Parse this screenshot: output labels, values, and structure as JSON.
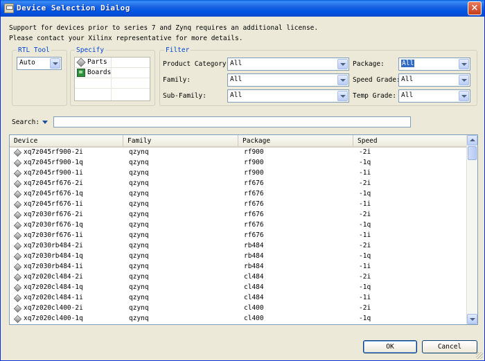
{
  "window": {
    "title": "Device Selection Dialog",
    "close_glyph": "×"
  },
  "info": {
    "line1": "Support for devices prior to series 7 and Zynq requires an additional license.",
    "line2": "Please contact your Xilinx representative for more details."
  },
  "rtl_tool": {
    "legend": "RTL Tool",
    "value": "Auto"
  },
  "specify": {
    "legend": "Specify",
    "items": [
      {
        "label": "Parts",
        "icon": "chip-icon"
      },
      {
        "label": "Boards",
        "icon": "board-icon"
      }
    ]
  },
  "filter": {
    "legend": "Filter",
    "product_category": {
      "label": "Product Category:",
      "value": "All"
    },
    "family": {
      "label": "Family:",
      "value": "All"
    },
    "sub_family": {
      "label": "Sub-Family:",
      "value": "All"
    },
    "package": {
      "label": "Package:",
      "value": "All"
    },
    "speed_grade": {
      "label": "Speed Grade:",
      "value": "All"
    },
    "temp_grade": {
      "label": "Temp Grade:",
      "value": "All"
    }
  },
  "search": {
    "label": "Search:",
    "value": ""
  },
  "table": {
    "columns": [
      "Device",
      "Family",
      "Package",
      "Speed"
    ],
    "rows": [
      [
        "xq7z045rf900-2i",
        "qzynq",
        "rf900",
        "-2i"
      ],
      [
        "xq7z045rf900-1q",
        "qzynq",
        "rf900",
        "-1q"
      ],
      [
        "xq7z045rf900-1i",
        "qzynq",
        "rf900",
        "-1i"
      ],
      [
        "xq7z045rf676-2i",
        "qzynq",
        "rf676",
        "-2i"
      ],
      [
        "xq7z045rf676-1q",
        "qzynq",
        "rf676",
        "-1q"
      ],
      [
        "xq7z045rf676-1i",
        "qzynq",
        "rf676",
        "-1i"
      ],
      [
        "xq7z030rf676-2i",
        "qzynq",
        "rf676",
        "-2i"
      ],
      [
        "xq7z030rf676-1q",
        "qzynq",
        "rf676",
        "-1q"
      ],
      [
        "xq7z030rf676-1i",
        "qzynq",
        "rf676",
        "-1i"
      ],
      [
        "xq7z030rb484-2i",
        "qzynq",
        "rb484",
        "-2i"
      ],
      [
        "xq7z030rb484-1q",
        "qzynq",
        "rb484",
        "-1q"
      ],
      [
        "xq7z030rb484-1i",
        "qzynq",
        "rb484",
        "-1i"
      ],
      [
        "xq7z020cl484-2i",
        "qzynq",
        "cl484",
        "-2i"
      ],
      [
        "xq7z020cl484-1q",
        "qzynq",
        "cl484",
        "-1q"
      ],
      [
        "xq7z020cl484-1i",
        "qzynq",
        "cl484",
        "-1i"
      ],
      [
        "xq7z020cl400-2i",
        "qzynq",
        "cl400",
        "-2i"
      ],
      [
        "xq7z020cl400-1q",
        "qzynq",
        "cl400",
        "-1q"
      ]
    ]
  },
  "buttons": {
    "ok": "OK",
    "cancel": "Cancel"
  }
}
